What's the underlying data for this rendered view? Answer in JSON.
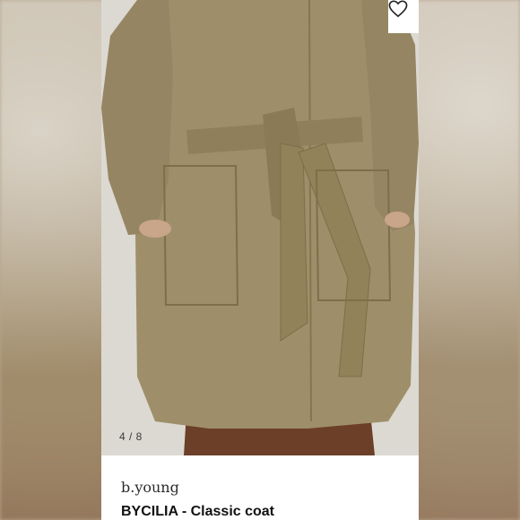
{
  "gallery": {
    "counter": "4 / 8",
    "favorite_icon": "heart-outline-icon"
  },
  "product": {
    "brand": "b.young",
    "title": "BYCILIA - Classic coat"
  },
  "colors": {
    "coat": "#9e8f6a",
    "trousers": "#6b3f28",
    "background": "#d8d5ce"
  }
}
